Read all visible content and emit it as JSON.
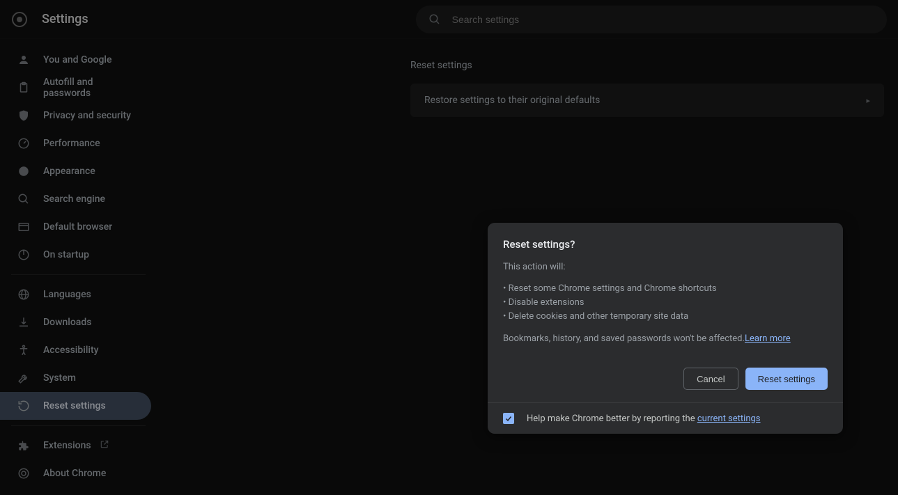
{
  "header": {
    "title": "Settings",
    "search_placeholder": "Search settings"
  },
  "sidebar": {
    "group1": [
      {
        "label": "You and Google"
      },
      {
        "label": "Autofill and passwords"
      },
      {
        "label": "Privacy and security"
      },
      {
        "label": "Performance"
      },
      {
        "label": "Appearance"
      },
      {
        "label": "Search engine"
      },
      {
        "label": "Default browser"
      },
      {
        "label": "On startup"
      }
    ],
    "group2": [
      {
        "label": "Languages"
      },
      {
        "label": "Downloads"
      },
      {
        "label": "Accessibility"
      },
      {
        "label": "System"
      },
      {
        "label": "Reset settings"
      }
    ],
    "group3": [
      {
        "label": "Extensions"
      },
      {
        "label": "About Chrome"
      }
    ]
  },
  "main": {
    "section_title": "Reset settings",
    "restore_label": "Restore settings to their original defaults"
  },
  "modal": {
    "title": "Reset settings?",
    "intro": "This action will:",
    "bullets": [
      "Reset some Chrome settings and Chrome shortcuts",
      "Disable extensions",
      "Delete cookies and other temporary site data"
    ],
    "footnote": "Bookmarks, history, and saved passwords won't be affected.",
    "learn_more": "Learn more",
    "cancel": "Cancel",
    "confirm": "Reset settings",
    "help_text": "Help make Chrome better by reporting the ",
    "help_link": "current settings",
    "checked": true
  }
}
